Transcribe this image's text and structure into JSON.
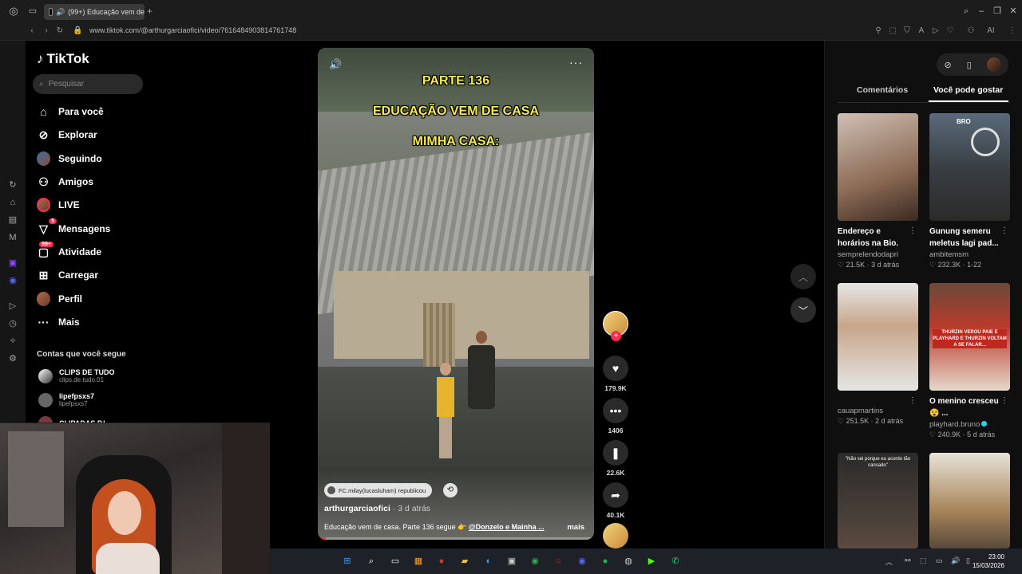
{
  "browser": {
    "tab_title": "(99+) Educação vem de",
    "new_tab": "+",
    "url": "www.tiktok.com/@arthurgarciaofici/video/7616484903814761748",
    "ai_label": "AI"
  },
  "sidebar": {
    "logo": "TikTok",
    "search_placeholder": "Pesquisar",
    "items": [
      {
        "label": "Para você",
        "icon": "home-icon"
      },
      {
        "label": "Explorar",
        "icon": "compass-icon"
      },
      {
        "label": "Seguindo",
        "icon": "following-avatar-icon"
      },
      {
        "label": "Amigos",
        "icon": "friends-icon"
      },
      {
        "label": "LIVE",
        "icon": "live-avatar-icon"
      },
      {
        "label": "Mensagens",
        "icon": "messages-icon",
        "badge": "5"
      },
      {
        "label": "Atividade",
        "icon": "activity-icon",
        "badge": "99+"
      },
      {
        "label": "Carregar",
        "icon": "upload-icon"
      },
      {
        "label": "Perfil",
        "icon": "profile-avatar-icon"
      },
      {
        "label": "Mais",
        "icon": "more-icon"
      }
    ],
    "following_title": "Contas que você segue",
    "following": [
      {
        "name": "CLIPS DE TUDO",
        "handle": "clips.de.tudo.01"
      },
      {
        "name": "lipefpsxs7",
        "handle": "lipefpsxs7"
      },
      {
        "name": "CLIPADAS P.L",
        "handle": ""
      }
    ]
  },
  "video": {
    "caption_lines": [
      "PARTE 136",
      "EDUCAÇÃO VEM DE CASA",
      "MIMHA CASA:"
    ],
    "repost_text": "FC.milay(lucasluham) republicou",
    "author": "arthurgarciaofici",
    "posted": "· 3 d atrás",
    "description": "Educação vem de casa. Parte 136 segue 👉 ",
    "mentions": "@Donzelo e Mainha ...",
    "more": "mais",
    "progress": 0.03
  },
  "actions": {
    "likes": "179.9K",
    "comments": "1406",
    "saves": "22.6K",
    "shares": "40.1K"
  },
  "right_panel": {
    "tabs": [
      "Comentários",
      "Você pode gostar"
    ],
    "active_tab": "Você pode gostar",
    "cards": [
      {
        "title": "Endereço e horários na Bio.",
        "user": "semprelendodapri",
        "likes": "21.5K",
        "ago": "3 d atrás",
        "verified": false
      },
      {
        "title": "Gunung semeru meletus lagi pad...",
        "user": "ambitemsm",
        "likes": "232.3K",
        "ago": "1-22",
        "verified": false
      },
      {
        "title": "",
        "user": "cauapmartins",
        "likes": "251.5K",
        "ago": "2 d atrás",
        "verified": false
      },
      {
        "title": "O menino cresceu 😵 ...",
        "user": "playhard.bruno",
        "likes": "240.9K",
        "ago": "5 d atrás",
        "verified": true
      },
      {
        "title": "",
        "user": "",
        "likes": "",
        "ago": "",
        "verified": false
      },
      {
        "title": "",
        "user": "",
        "likes": "",
        "ago": "",
        "verified": false
      }
    ],
    "thumb_texts": [
      "",
      "BRO",
      "",
      "THURZIN VEROU PAIE E PLAYHARD E THURZIN VOLTAM A SE FALAR...",
      "\"Não sei porque eu acordo tão cansado\"",
      ""
    ]
  },
  "taskbar": {
    "time": "23:00",
    "date": "15/03/2026"
  },
  "colors": {
    "accent": "#fe2c55",
    "caption": "#f4ea5a",
    "verified": "#20d5ec"
  }
}
